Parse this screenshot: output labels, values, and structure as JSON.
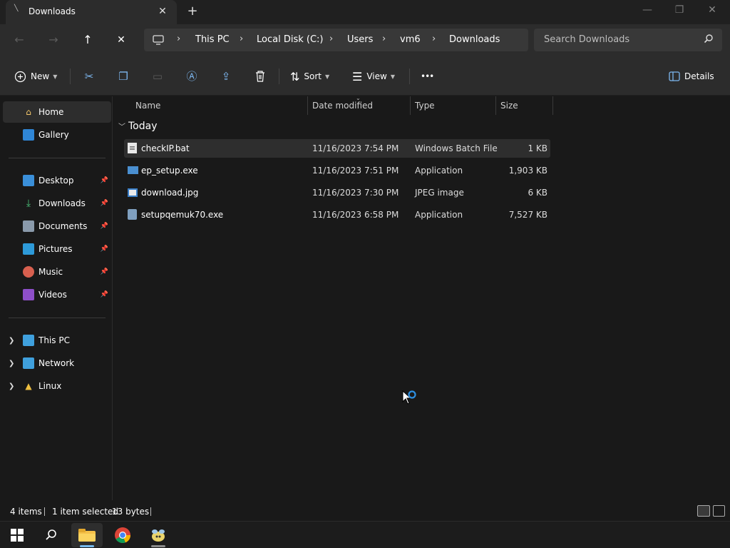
{
  "window": {
    "tab_title": "Downloads",
    "tab_close": "✕",
    "new_tab": "+",
    "minimize": "—",
    "maximize": "❐",
    "close": "✕"
  },
  "nav": {
    "back": "←",
    "forward": "→",
    "up": "↑",
    "stop": "✕"
  },
  "breadcrumb": [
    "This PC",
    "Local Disk (C:)",
    "Users",
    "vm6",
    "Downloads"
  ],
  "search": {
    "placeholder": "Search Downloads"
  },
  "toolbar": {
    "new_label": "New",
    "sort_label": "Sort",
    "view_label": "View",
    "more_label": "•••",
    "details_label": "Details"
  },
  "sidebar": {
    "home": "Home",
    "gallery": "Gallery",
    "pinned": [
      "Desktop",
      "Downloads",
      "Documents",
      "Pictures",
      "Music",
      "Videos"
    ],
    "drives": [
      "This PC",
      "Network",
      "Linux"
    ]
  },
  "columns": [
    "Name",
    "Date modified",
    "Type",
    "Size"
  ],
  "group": "Today",
  "files": [
    {
      "name": "checkIP.bat",
      "date": "11/16/2023 7:54 PM",
      "type": "Windows Batch File",
      "size": "1 KB"
    },
    {
      "name": "ep_setup.exe",
      "date": "11/16/2023 7:51 PM",
      "type": "Application",
      "size": "1,903 KB"
    },
    {
      "name": "download.jpg",
      "date": "11/16/2023 7:30 PM",
      "type": "JPEG image",
      "size": "6 KB"
    },
    {
      "name": "setupqemuk70.exe",
      "date": "11/16/2023 6:58 PM",
      "type": "Application",
      "size": "7,527 KB"
    }
  ],
  "status": {
    "count": "4 items",
    "selected": "1 item selected",
    "bytes": "13 bytes"
  },
  "colors": {
    "accent": "#76b9ed",
    "background": "#191919",
    "bar": "#2c2c2c"
  }
}
